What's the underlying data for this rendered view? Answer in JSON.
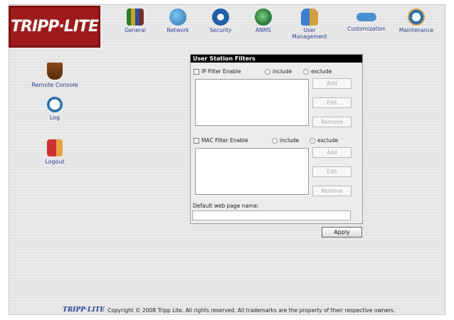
{
  "brand": {
    "logo_text": "TRIPP·LITE",
    "logo_color": "#9e1b1b"
  },
  "topnav": {
    "items": [
      {
        "label": "General",
        "icon": "books-icon"
      },
      {
        "label": "Network",
        "icon": "network-globe-icon"
      },
      {
        "label": "Security",
        "icon": "lock-icon"
      },
      {
        "label": "ANMS",
        "icon": "globe-icon"
      },
      {
        "label": "User Management",
        "icon": "users-icon"
      },
      {
        "label": "Customization",
        "icon": "connector-icon"
      },
      {
        "label": "Maintenance",
        "icon": "maintenance-clock-icon"
      }
    ]
  },
  "sidebar": {
    "items": [
      {
        "label": "Remote Console",
        "icon": "coffee-cup-icon"
      },
      {
        "label": "Log",
        "icon": "clock-icon"
      },
      {
        "label": "Logout",
        "icon": "exit-door-icon"
      }
    ]
  },
  "panel": {
    "title": "User Station Filters",
    "ip": {
      "enable_label": "IP Filter Enable",
      "include_label": "include",
      "exclude_label": "exclude",
      "selected": "exclude",
      "add_label": "Add",
      "edit_label": "Edit",
      "remove_label": "Remove"
    },
    "mac": {
      "enable_label": "MAC Filter Enable",
      "include_label": "include",
      "exclude_label": "exclude",
      "selected": "exclude",
      "add_label": "Add",
      "edit_label": "Edit",
      "remove_label": "Remove"
    },
    "default_page_label": "Default web page name:",
    "default_page_value": ""
  },
  "apply_label": "Apply",
  "footer": {
    "logo_text": "TRIPP·LITE",
    "copyright": "Copyright © 2008 Tripp Lite. All rights reserved. All trademarks are the property of their respective owners."
  }
}
